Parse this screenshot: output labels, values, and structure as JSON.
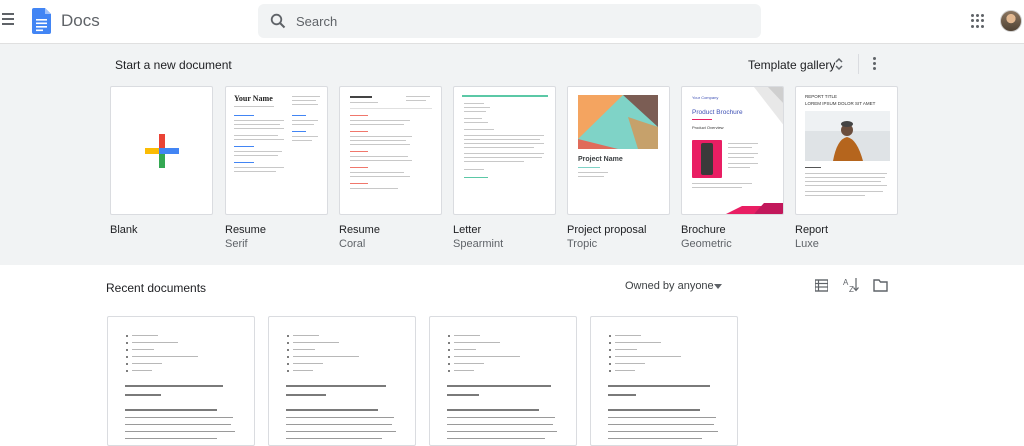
{
  "header": {
    "app_title": "Docs",
    "search_placeholder": "Search"
  },
  "templates_section": {
    "title": "Start a new document",
    "gallery_label": "Template gallery",
    "items": [
      {
        "name": "Blank",
        "sub": ""
      },
      {
        "name": "Resume",
        "sub": "Serif"
      },
      {
        "name": "Resume",
        "sub": "Coral"
      },
      {
        "name": "Letter",
        "sub": "Spearmint"
      },
      {
        "name": "Project proposal",
        "sub": "Tropic"
      },
      {
        "name": "Brochure",
        "sub": "Geometric"
      },
      {
        "name": "Report",
        "sub": "Luxe"
      }
    ],
    "thumb_text": {
      "serif_name": "Your Name",
      "proposal_title": "Project Name",
      "brochure_company": "Your Company",
      "brochure_title": "Product Brochure",
      "brochure_overview": "Product Overview",
      "report_title": "REPORT TITLE",
      "report_sub": "LOREM IPSUM DOLOR SIT AMET"
    }
  },
  "recent_section": {
    "title": "Recent documents",
    "owner_filter": "Owned by anyone"
  },
  "colors": {
    "accent_blue": "#4285f4",
    "red": "#ea4335",
    "yellow": "#fbbc04",
    "green": "#34a853",
    "template_bg": "#f1f3f4",
    "coral": "#f0776c",
    "spearmint": "#5bc8a6",
    "brochure_pink": "#e91e63"
  }
}
